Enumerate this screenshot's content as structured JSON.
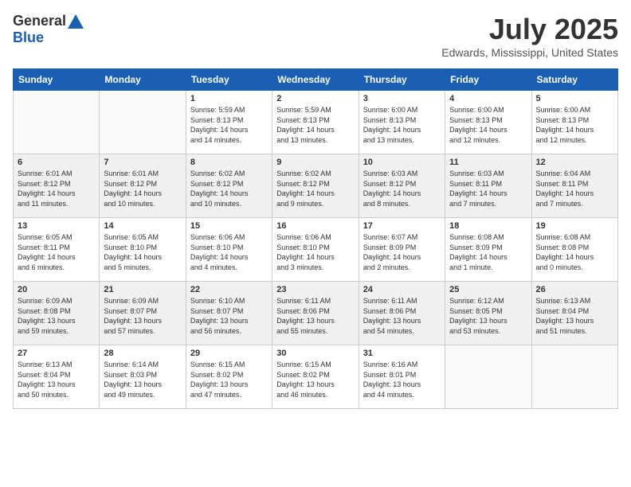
{
  "header": {
    "logo_general": "General",
    "logo_blue": "Blue",
    "month_title": "July 2025",
    "location": "Edwards, Mississippi, United States"
  },
  "weekdays": [
    "Sunday",
    "Monday",
    "Tuesday",
    "Wednesday",
    "Thursday",
    "Friday",
    "Saturday"
  ],
  "weeks": [
    [
      {
        "day": "",
        "info": ""
      },
      {
        "day": "",
        "info": ""
      },
      {
        "day": "1",
        "info": "Sunrise: 5:59 AM\nSunset: 8:13 PM\nDaylight: 14 hours\nand 14 minutes."
      },
      {
        "day": "2",
        "info": "Sunrise: 5:59 AM\nSunset: 8:13 PM\nDaylight: 14 hours\nand 13 minutes."
      },
      {
        "day": "3",
        "info": "Sunrise: 6:00 AM\nSunset: 8:13 PM\nDaylight: 14 hours\nand 13 minutes."
      },
      {
        "day": "4",
        "info": "Sunrise: 6:00 AM\nSunset: 8:13 PM\nDaylight: 14 hours\nand 12 minutes."
      },
      {
        "day": "5",
        "info": "Sunrise: 6:00 AM\nSunset: 8:13 PM\nDaylight: 14 hours\nand 12 minutes."
      }
    ],
    [
      {
        "day": "6",
        "info": "Sunrise: 6:01 AM\nSunset: 8:12 PM\nDaylight: 14 hours\nand 11 minutes."
      },
      {
        "day": "7",
        "info": "Sunrise: 6:01 AM\nSunset: 8:12 PM\nDaylight: 14 hours\nand 10 minutes."
      },
      {
        "day": "8",
        "info": "Sunrise: 6:02 AM\nSunset: 8:12 PM\nDaylight: 14 hours\nand 10 minutes."
      },
      {
        "day": "9",
        "info": "Sunrise: 6:02 AM\nSunset: 8:12 PM\nDaylight: 14 hours\nand 9 minutes."
      },
      {
        "day": "10",
        "info": "Sunrise: 6:03 AM\nSunset: 8:12 PM\nDaylight: 14 hours\nand 8 minutes."
      },
      {
        "day": "11",
        "info": "Sunrise: 6:03 AM\nSunset: 8:11 PM\nDaylight: 14 hours\nand 7 minutes."
      },
      {
        "day": "12",
        "info": "Sunrise: 6:04 AM\nSunset: 8:11 PM\nDaylight: 14 hours\nand 7 minutes."
      }
    ],
    [
      {
        "day": "13",
        "info": "Sunrise: 6:05 AM\nSunset: 8:11 PM\nDaylight: 14 hours\nand 6 minutes."
      },
      {
        "day": "14",
        "info": "Sunrise: 6:05 AM\nSunset: 8:10 PM\nDaylight: 14 hours\nand 5 minutes."
      },
      {
        "day": "15",
        "info": "Sunrise: 6:06 AM\nSunset: 8:10 PM\nDaylight: 14 hours\nand 4 minutes."
      },
      {
        "day": "16",
        "info": "Sunrise: 6:06 AM\nSunset: 8:10 PM\nDaylight: 14 hours\nand 3 minutes."
      },
      {
        "day": "17",
        "info": "Sunrise: 6:07 AM\nSunset: 8:09 PM\nDaylight: 14 hours\nand 2 minutes."
      },
      {
        "day": "18",
        "info": "Sunrise: 6:08 AM\nSunset: 8:09 PM\nDaylight: 14 hours\nand 1 minute."
      },
      {
        "day": "19",
        "info": "Sunrise: 6:08 AM\nSunset: 8:08 PM\nDaylight: 14 hours\nand 0 minutes."
      }
    ],
    [
      {
        "day": "20",
        "info": "Sunrise: 6:09 AM\nSunset: 8:08 PM\nDaylight: 13 hours\nand 59 minutes."
      },
      {
        "day": "21",
        "info": "Sunrise: 6:09 AM\nSunset: 8:07 PM\nDaylight: 13 hours\nand 57 minutes."
      },
      {
        "day": "22",
        "info": "Sunrise: 6:10 AM\nSunset: 8:07 PM\nDaylight: 13 hours\nand 56 minutes."
      },
      {
        "day": "23",
        "info": "Sunrise: 6:11 AM\nSunset: 8:06 PM\nDaylight: 13 hours\nand 55 minutes."
      },
      {
        "day": "24",
        "info": "Sunrise: 6:11 AM\nSunset: 8:06 PM\nDaylight: 13 hours\nand 54 minutes."
      },
      {
        "day": "25",
        "info": "Sunrise: 6:12 AM\nSunset: 8:05 PM\nDaylight: 13 hours\nand 53 minutes."
      },
      {
        "day": "26",
        "info": "Sunrise: 6:13 AM\nSunset: 8:04 PM\nDaylight: 13 hours\nand 51 minutes."
      }
    ],
    [
      {
        "day": "27",
        "info": "Sunrise: 6:13 AM\nSunset: 8:04 PM\nDaylight: 13 hours\nand 50 minutes."
      },
      {
        "day": "28",
        "info": "Sunrise: 6:14 AM\nSunset: 8:03 PM\nDaylight: 13 hours\nand 49 minutes."
      },
      {
        "day": "29",
        "info": "Sunrise: 6:15 AM\nSunset: 8:02 PM\nDaylight: 13 hours\nand 47 minutes."
      },
      {
        "day": "30",
        "info": "Sunrise: 6:15 AM\nSunset: 8:02 PM\nDaylight: 13 hours\nand 46 minutes."
      },
      {
        "day": "31",
        "info": "Sunrise: 6:16 AM\nSunset: 8:01 PM\nDaylight: 13 hours\nand 44 minutes."
      },
      {
        "day": "",
        "info": ""
      },
      {
        "day": "",
        "info": ""
      }
    ]
  ]
}
